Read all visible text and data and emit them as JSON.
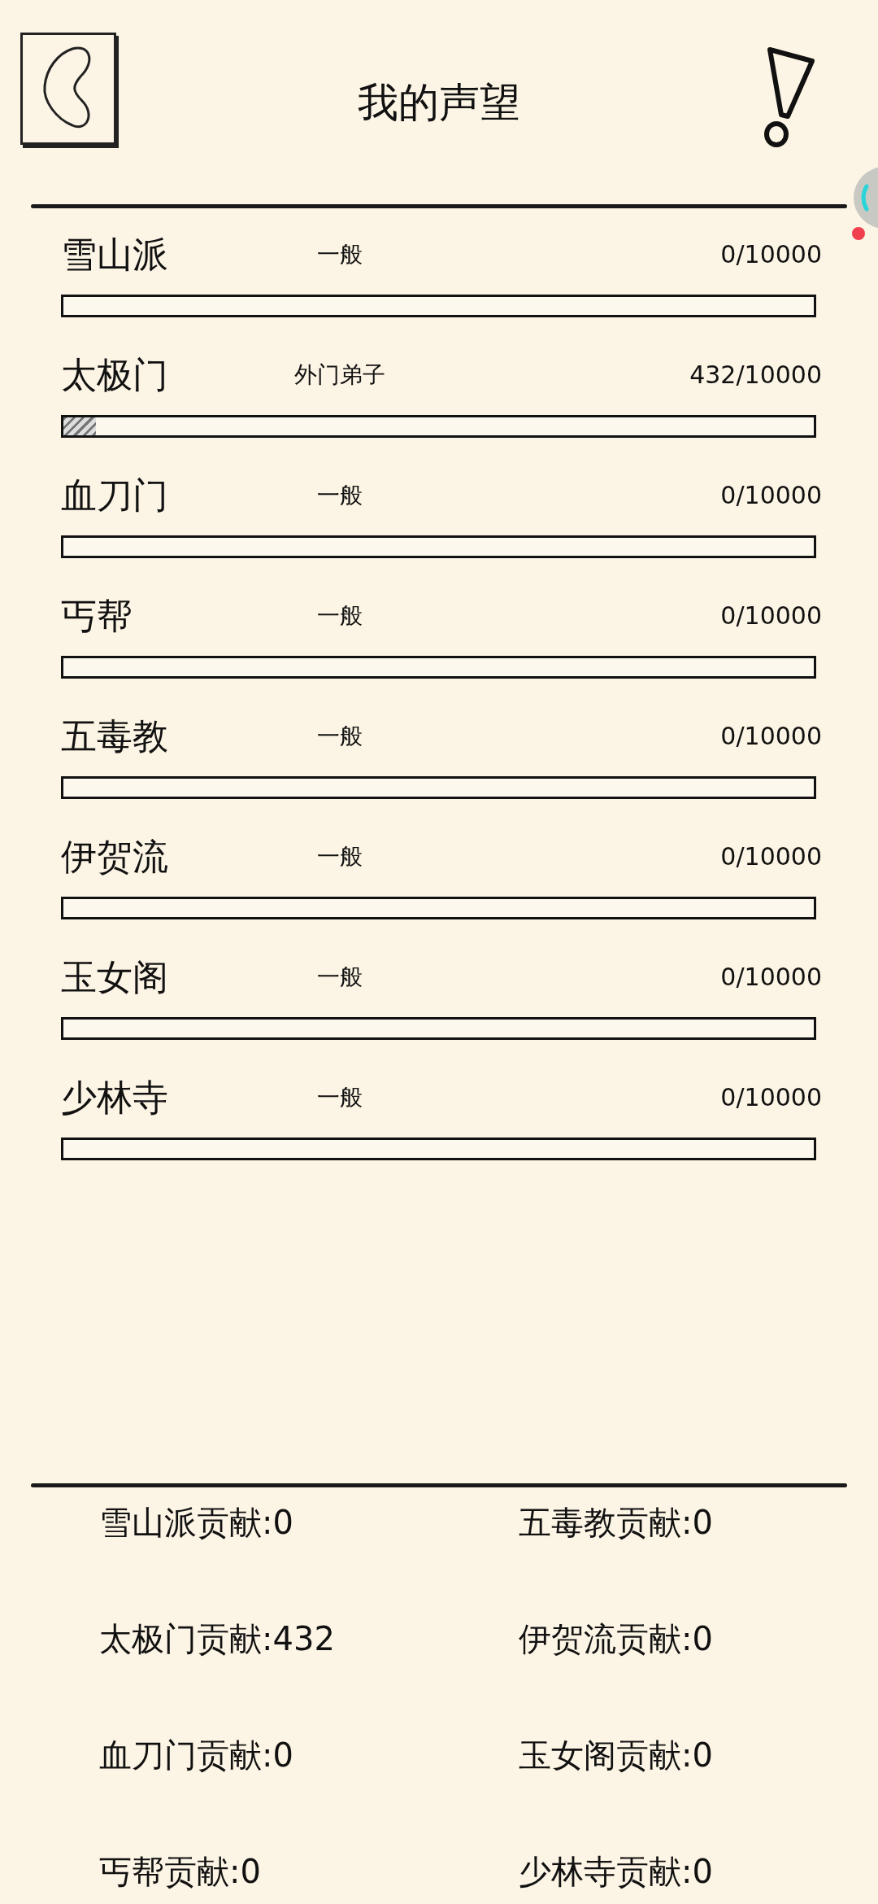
{
  "title": "我的声望",
  "factions": [
    {
      "name": "雪山派",
      "rank": "一般",
      "value": "0/10000",
      "level": 0
    },
    {
      "name": "太极门",
      "rank": "外门弟子",
      "value": "432/10000",
      "level": 0.0432
    },
    {
      "name": "血刀门",
      "rank": "一般",
      "value": "0/10000",
      "level": 0
    },
    {
      "name": "丐帮",
      "rank": "一般",
      "value": "0/10000",
      "level": 0
    },
    {
      "name": "五毒教",
      "rank": "一般",
      "value": "0/10000",
      "level": 0
    },
    {
      "name": "伊贺流",
      "rank": "一般",
      "value": "0/10000",
      "level": 0
    },
    {
      "name": "玉女阁",
      "rank": "一般",
      "value": "0/10000",
      "level": 0
    },
    {
      "name": "少林寺",
      "rank": "一般",
      "value": "0/10000",
      "level": 0
    }
  ],
  "contributions": [
    "雪山派贡献:0",
    "五毒教贡献:0",
    "太极门贡献:432",
    "伊贺流贡献:0",
    "血刀门贡献:0",
    "玉女阁贡献:0",
    "丐帮贡献:0",
    "少林寺贡献:0"
  ]
}
